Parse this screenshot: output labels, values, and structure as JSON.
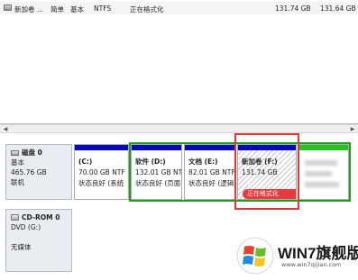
{
  "volume_list": {
    "row": {
      "volume": "新加卷 ...",
      "layout": "简单",
      "type": "基本",
      "filesystem": "NTFS",
      "status": "正在格式化",
      "capacity": "131.74 GB",
      "free": "131.64 GB"
    }
  },
  "disk0": {
    "name": "磁盘 0",
    "type": "基本",
    "size": "465.76 GB",
    "status": "联机",
    "partitions": [
      {
        "name": "(C:)",
        "size": "70.00 GB NTF",
        "status": "状态良好 (系统"
      },
      {
        "name": "软件 (D:)",
        "size": "132.01 GB NT",
        "status": "状态良好 (页面"
      },
      {
        "name": "文档 (E:)",
        "size": "82.01 GB NTF",
        "status": "状态良好 (逻辑"
      },
      {
        "name": "新加卷 (F:)",
        "size": "131.74 GB",
        "status": "正在格式化"
      }
    ]
  },
  "cdrom0": {
    "name": "CD-ROM 0",
    "drive": "DVD (G:)",
    "media": "无媒体"
  },
  "watermark": {
    "title": "WIN7旗舰版",
    "url": "www.win7qijian.com"
  },
  "colors": {
    "primary_partition_band": "#0a0ab8",
    "extended_partition_border": "#1aa31a",
    "free_space_band": "#22c322",
    "format_progress": "#e8393d",
    "highlight_box": "#e53535"
  }
}
